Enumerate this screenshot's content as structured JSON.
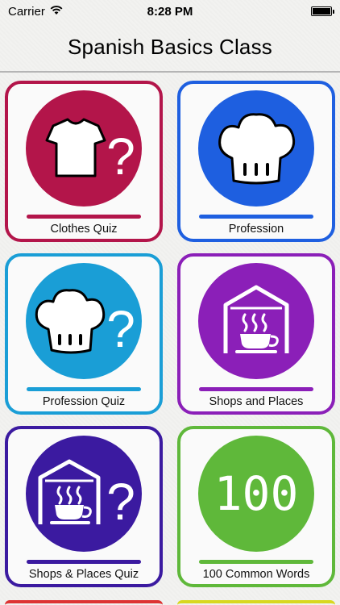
{
  "status_bar": {
    "carrier": "Carrier",
    "time": "8:28 PM",
    "wifi_icon": "wifi-icon",
    "battery_icon": "battery-icon"
  },
  "header": {
    "title": "Spanish Basics Class"
  },
  "tiles": [
    {
      "label": "Clothes Quiz",
      "icon": "shirt-question-icon",
      "border": "#b3154a",
      "circle": "#b3154a",
      "bar": "#b3154a"
    },
    {
      "label": "Profession",
      "icon": "chef-hat-icon",
      "border": "#1e5fe0",
      "circle": "#1e5fe0",
      "bar": "#1e5fe0"
    },
    {
      "label": "Profession Quiz",
      "icon": "chef-hat-question-icon",
      "border": "#1a9ed6",
      "circle": "#1a9ed6",
      "bar": "#1a9ed6"
    },
    {
      "label": "Shops and Places",
      "icon": "shop-coffee-icon",
      "border": "#8b1fb8",
      "circle": "#8b1fb8",
      "bar": "#8b1fb8"
    },
    {
      "label": "Shops & Places Quiz",
      "icon": "shop-coffee-question-icon",
      "border": "#3b1aa0",
      "circle": "#3b1aa0",
      "bar": "#3b1aa0"
    },
    {
      "label": "100 Common Words",
      "icon": "number-100-icon",
      "icon_text": "100",
      "border": "#5fb83a",
      "circle": "#5fb83a",
      "bar": "#5fb83a"
    }
  ]
}
